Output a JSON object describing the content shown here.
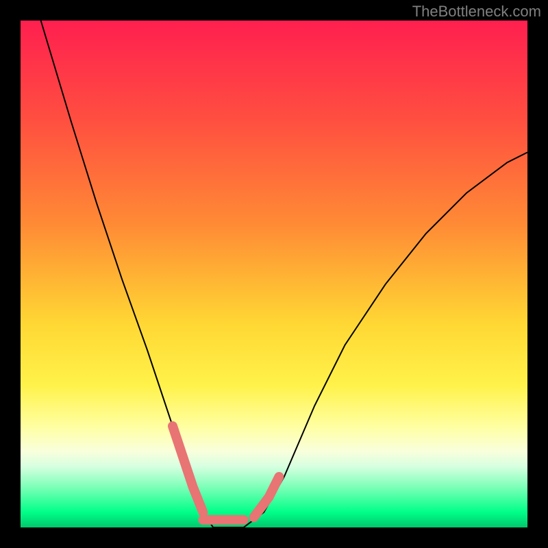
{
  "watermark": "TheBottleneck.com",
  "colors": {
    "gradient_top": "#ff1f4f",
    "gradient_mid": "#ffd834",
    "gradient_bottom": "#00c76d",
    "curve": "#000000",
    "highlight": "#e87474",
    "frame": "#000000"
  },
  "chart_data": {
    "type": "line",
    "title": "",
    "xlabel": "",
    "ylabel": "",
    "xlim": [
      0,
      100
    ],
    "ylim": [
      0,
      100
    ],
    "grid": false,
    "series": [
      {
        "name": "bottleneck-curve",
        "x": [
          4,
          10,
          15,
          20,
          25,
          30,
          34,
          36,
          38,
          40,
          44,
          48,
          52,
          58,
          64,
          72,
          80,
          88,
          96,
          100
        ],
        "y": [
          100,
          80,
          64,
          49,
          35,
          20,
          8,
          3,
          0,
          0,
          0,
          3,
          10,
          24,
          36,
          48,
          58,
          66,
          72,
          74
        ]
      }
    ],
    "highlight_segment": {
      "x_range": [
        30,
        50
      ],
      "description": "pink rounded segment near curve minimum"
    }
  }
}
